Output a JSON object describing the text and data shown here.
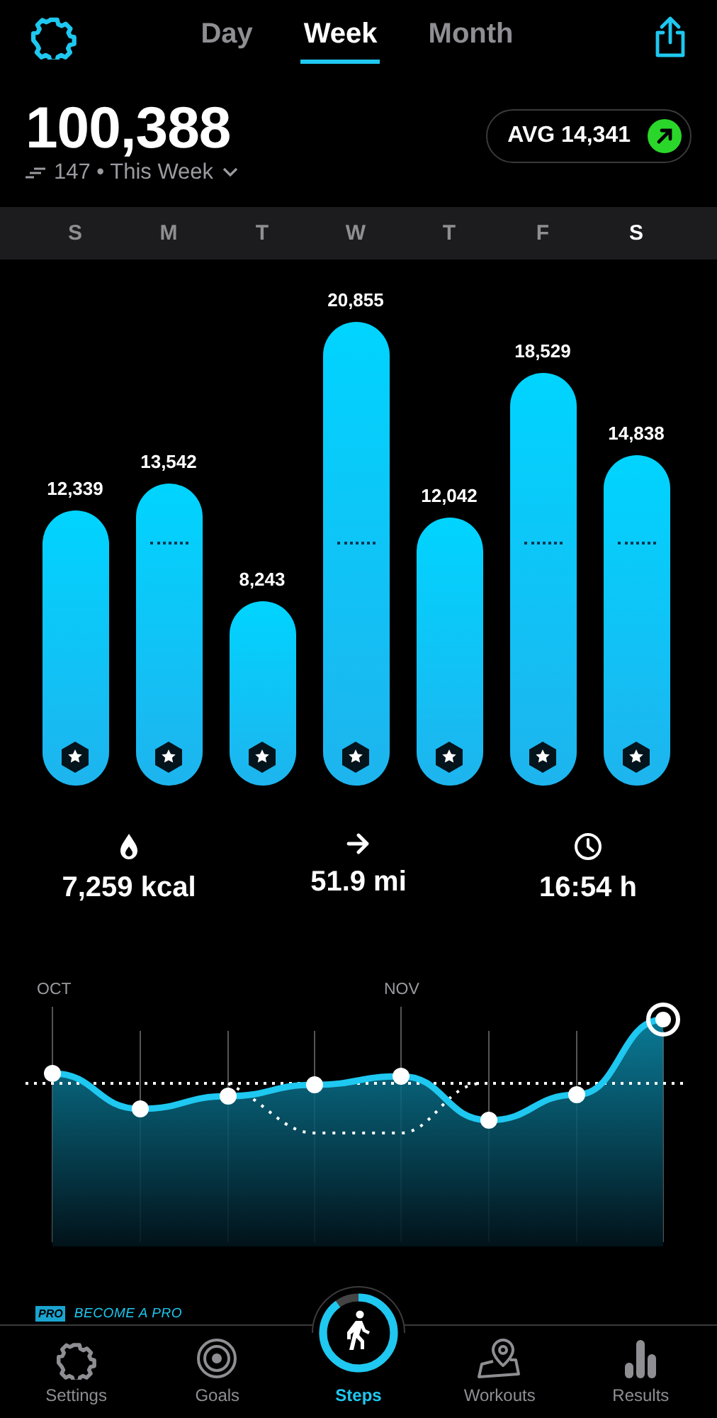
{
  "tabs": [
    {
      "label": "Day",
      "selected": false
    },
    {
      "label": "Week",
      "selected": true
    },
    {
      "label": "Month",
      "selected": false
    }
  ],
  "summary": {
    "total": "100,388",
    "streak": "147 • This Week",
    "average": "AVG 14,341"
  },
  "days": [
    {
      "selected": false
    },
    {
      "selected": false
    },
    {
      "selected": false
    },
    {
      "selected": false
    },
    {
      "selected": false
    },
    {
      "selected": false
    },
    {
      "selected": true
    }
  ],
  "week_chart": {
    "chart_data": {
      "type": "bar",
      "categories": [
        "S",
        "M",
        "T",
        "W",
        "T",
        "F",
        "S"
      ],
      "values": [
        12339,
        13542,
        8243,
        20855,
        12042,
        18529,
        14838
      ],
      "value_labels": [
        "12,339",
        "13,542",
        "8,243",
        "20,855",
        "12,042",
        "18,529",
        "14,838"
      ],
      "data_labels": true
    }
  },
  "stats": [
    {
      "kind": "calories",
      "value": "7,259 kcal"
    },
    {
      "kind": "distance",
      "value": "51.9 mi"
    },
    {
      "kind": "duration",
      "value": "16:54 h"
    }
  ],
  "trend": {
    "months": [
      "OCT",
      "NOV"
    ]
  },
  "promo": {
    "badge": "PRO",
    "text": "BECOME A PRO"
  },
  "nav": [
    {
      "kind": "settings",
      "label": "Settings",
      "selected": false
    },
    {
      "kind": "goals",
      "label": "Goals",
      "selected": false
    },
    {
      "kind": "steps",
      "label": "Steps",
      "selected": true,
      "level": 0.9
    },
    {
      "kind": "workouts",
      "label": "Workouts",
      "selected": false
    },
    {
      "kind": "results",
      "label": "Results",
      "selected": false
    }
  ]
}
